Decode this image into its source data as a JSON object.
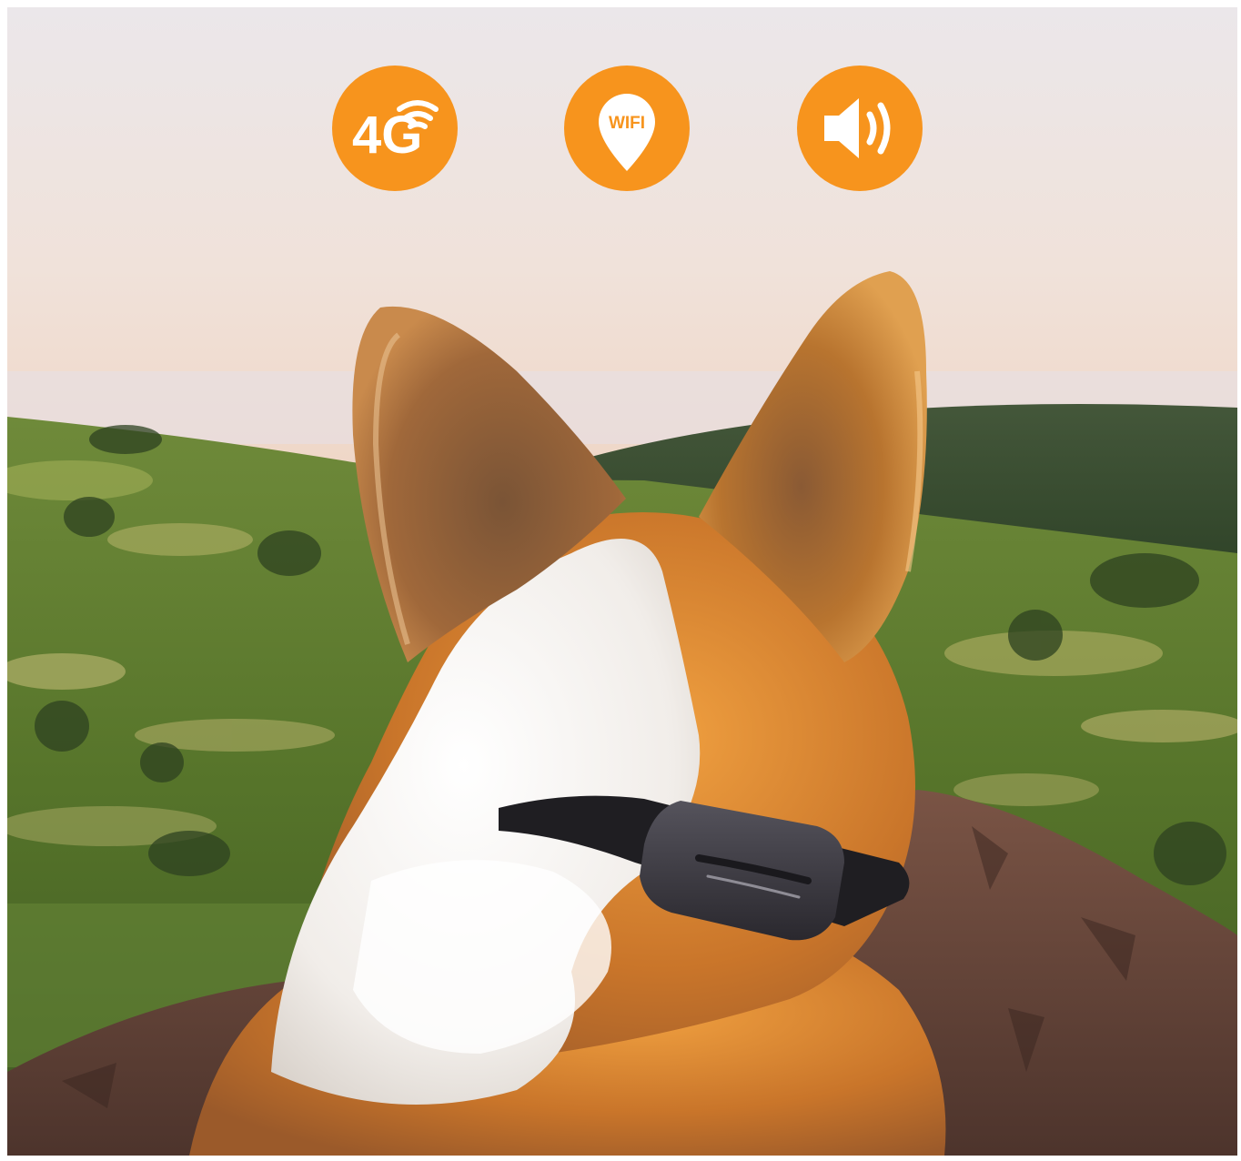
{
  "feature_badges": [
    {
      "icon": "4g-signal-icon",
      "text": "4G"
    },
    {
      "icon": "wifi-location-pin-icon",
      "text": "WIFI"
    },
    {
      "icon": "speaker-sound-icon",
      "text": ""
    }
  ],
  "colors": {
    "badge_orange": "#F7941D",
    "badge_foreground": "#FFFFFF",
    "sky_top": "#EDE8EA",
    "sky_horizon": "#F3DCCB",
    "hills_green": "#5E7A2B",
    "fur_orange": "#C9752A",
    "fur_white": "#F4F1EE",
    "collar_dark": "#2E2C33",
    "rock_brown": "#6E4A3E"
  },
  "scene": {
    "subject": "corgi-dog",
    "accessory": "gps-tracker-collar"
  }
}
